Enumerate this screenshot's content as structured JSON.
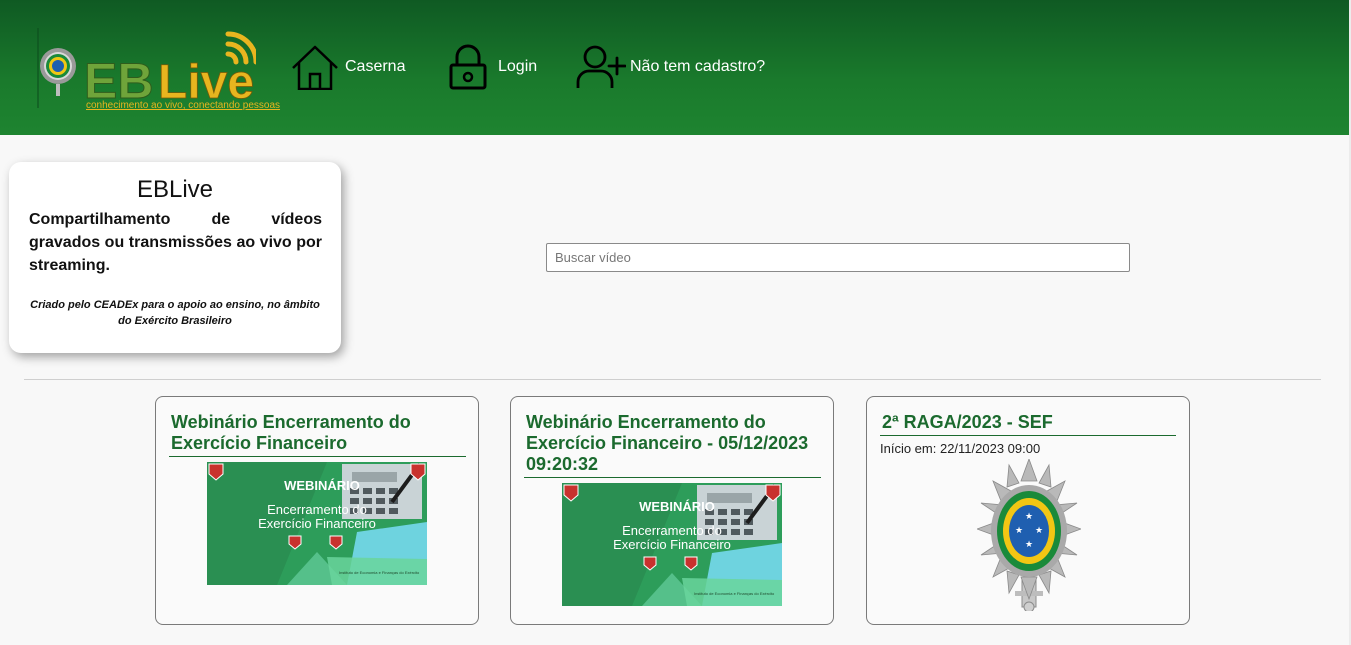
{
  "header": {
    "logo": {
      "wordmark": "EBLive",
      "tagline": "conhecimento ao vivo, conectando pessoas"
    },
    "nav": [
      {
        "label": "Caserna",
        "icon": "home-icon"
      },
      {
        "label": "Login",
        "icon": "lock-icon"
      },
      {
        "label": "Não tem cadastro?",
        "icon": "user-plus-icon"
      }
    ]
  },
  "info": {
    "title": "EBLive",
    "description": "Compartilhamento de vídeos gravados ou transmissões ao vivo por streaming.",
    "credit": "Criado pelo CEADEx para o apoio ao ensino, no âmbito do Exército Brasileiro"
  },
  "search": {
    "placeholder": "Buscar vídeo",
    "value": ""
  },
  "videos": [
    {
      "title": "Webinário Encerramento do Exercício Financeiro",
      "thumb": {
        "heading": "WEBINÁRIO",
        "line1": "Encerramento do",
        "line2": "Exercício Financeiro",
        "footer": "Instituto de Economia e Finanças do Exército"
      }
    },
    {
      "title": "Webinário Encerramento do Exercício Financeiro - 05/12/2023 09:20:32",
      "thumb": {
        "heading": "WEBINÁRIO",
        "line1": "Encerramento do",
        "line2": "Exercício Financeiro",
        "footer": "Instituto de Economia e Finanças do Exército"
      }
    },
    {
      "title": "2ª RAGA/2023 - SEF",
      "start": "Início em: 22/11/2023 09:00"
    }
  ],
  "colors": {
    "header_dark": "#0f5a23",
    "header_light": "#1e8430",
    "card_title": "#1b6a2e",
    "logo_gold": "#e8b51f",
    "logo_green": "#6fa43a"
  }
}
